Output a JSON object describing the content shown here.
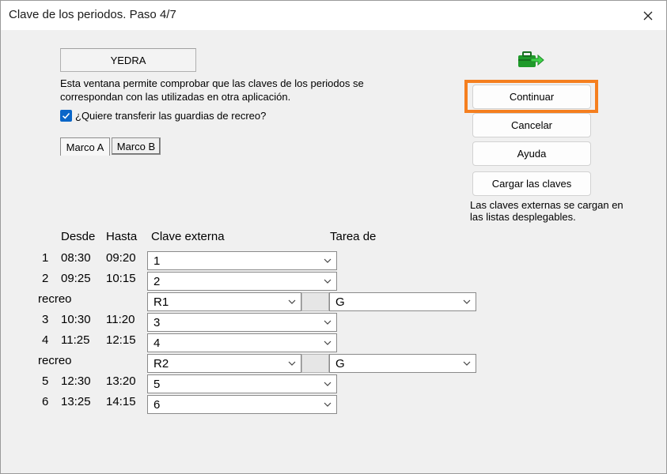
{
  "window": {
    "title": "Clave de los periodos. Paso 4/7"
  },
  "name_box": "YEDRA",
  "description": "Esta ventana permite comprobar que las claves de los periodos se corresponan con las utilizadas en otra aplicación.",
  "description_lines": [
    "Esta ventana permite comprobar que las claves de los periodos se",
    "correspondan con las utilizadas en otra aplicación."
  ],
  "checkbox": {
    "label": "¿Quiere transferir las guardias de recreo?",
    "checked": true
  },
  "tabs": [
    "Marco A",
    "Marco B"
  ],
  "buttons": {
    "continuar": "Continuar",
    "cancelar": "Cancelar",
    "ayuda": "Ayuda",
    "cargar": "Cargar las claves"
  },
  "note": "Las claves externas se cargan en las listas desplegables.",
  "note_lines": [
    "Las claves externas se cargan en",
    "las listas desplegables."
  ],
  "headers": {
    "desde": "Desde",
    "hasta": "Hasta",
    "clave": "Clave externa",
    "tarea": "Tarea de"
  },
  "rows": [
    {
      "num": "1",
      "desde": "08:30",
      "hasta": "09:20",
      "clave": "1"
    },
    {
      "num": "2",
      "desde": "09:25",
      "hasta": "10:15",
      "clave": "2"
    },
    {
      "label": "recreo",
      "clave": "R1",
      "tarea": "G"
    },
    {
      "num": "3",
      "desde": "10:30",
      "hasta": "11:20",
      "clave": "3"
    },
    {
      "num": "4",
      "desde": "11:25",
      "hasta": "12:15",
      "clave": "4"
    },
    {
      "label": "recreo",
      "clave": "R2",
      "tarea": "G"
    },
    {
      "num": "5",
      "desde": "12:30",
      "hasta": "13:20",
      "clave": "5"
    },
    {
      "num": "6",
      "desde": "13:25",
      "hasta": "14:15",
      "clave": "6"
    }
  ],
  "colors": {
    "highlight": "#f57f1f",
    "checkbox": "#0a66c8",
    "icon_green": "#1f9a2a"
  },
  "icons": {
    "close": "close-icon",
    "export": "export-briefcase-icon",
    "dropdown": "chevron-down-icon",
    "check": "checkmark-icon"
  }
}
